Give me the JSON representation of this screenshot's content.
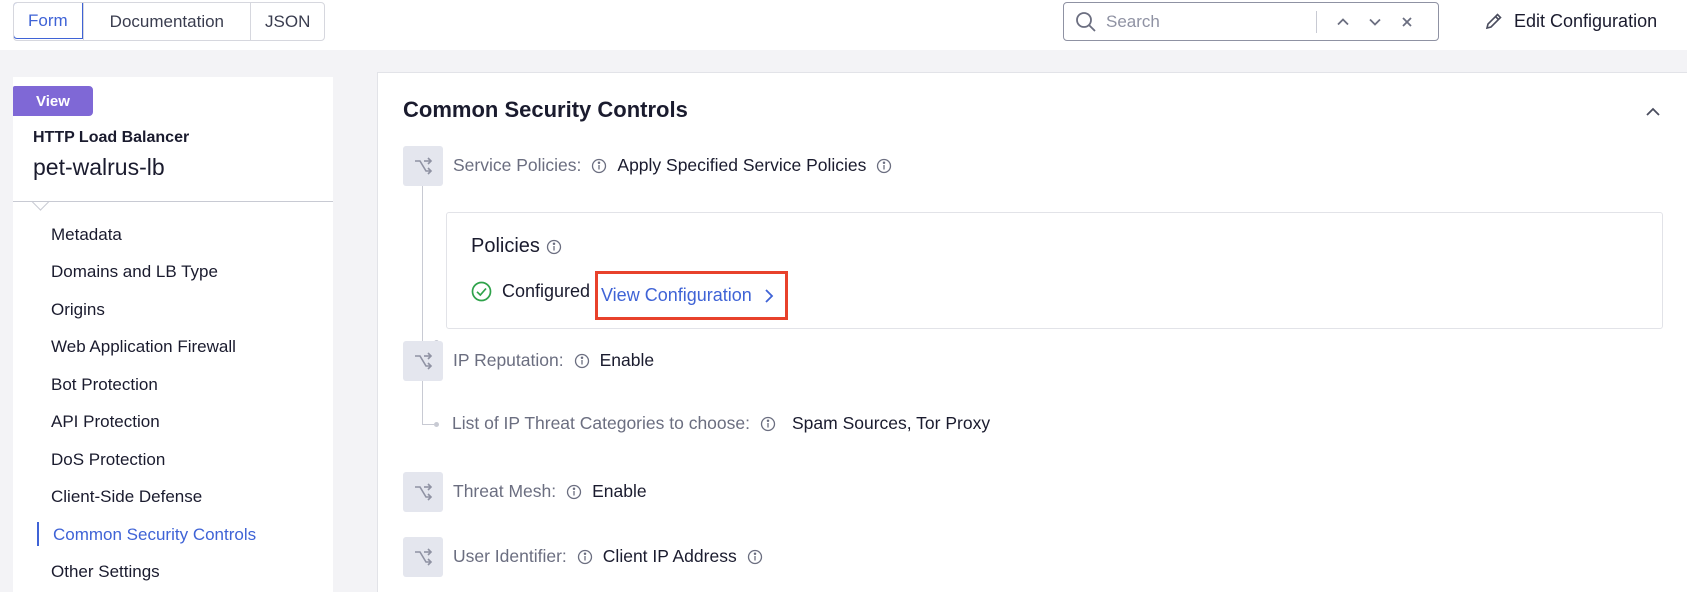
{
  "toolbar": {
    "tabs": [
      {
        "label": "Form",
        "active": true
      },
      {
        "label": "Documentation",
        "active": false
      },
      {
        "label": "JSON",
        "active": false
      }
    ],
    "search_placeholder": "Search",
    "edit_label": "Edit Configuration"
  },
  "sidebar": {
    "badge": "View",
    "object_type": "HTTP Load Balancer",
    "object_name": "pet-walrus-lb",
    "items": [
      {
        "label": "Metadata"
      },
      {
        "label": "Domains and LB Type"
      },
      {
        "label": "Origins"
      },
      {
        "label": "Web Application Firewall"
      },
      {
        "label": "Bot Protection"
      },
      {
        "label": "API Protection"
      },
      {
        "label": "DoS Protection"
      },
      {
        "label": "Client-Side Defense"
      },
      {
        "label": "Common Security Controls",
        "active": true
      },
      {
        "label": "Other Settings"
      }
    ]
  },
  "main": {
    "section_title": "Common Security Controls",
    "service_policies": {
      "label": "Service Policies:",
      "value": "Apply Specified Service Policies"
    },
    "policies": {
      "title": "Policies",
      "status": "Configured",
      "link": "View Configuration"
    },
    "ip_reputation": {
      "label": "IP Reputation:",
      "value": "Enable"
    },
    "ip_threat": {
      "label": "List of IP Threat Categories to choose:",
      "value": "Spam Sources, Tor Proxy"
    },
    "threat_mesh": {
      "label": "Threat Mesh:",
      "value": "Enable"
    },
    "user_identifier": {
      "label": "User Identifier:",
      "value": "Client IP Address"
    }
  },
  "colors": {
    "accent": "#3f63d6",
    "badge": "#7f68d6",
    "success": "#2ea24a",
    "highlight": "#e8412b"
  }
}
